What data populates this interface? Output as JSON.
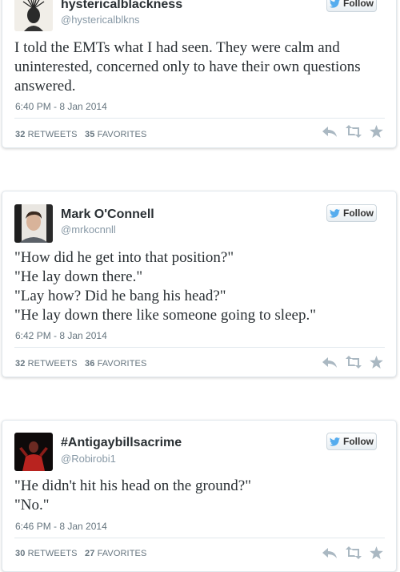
{
  "tweets": [
    {
      "name": "hystericalblackness",
      "handle": "@hystericalblkns",
      "follow_label": "Follow",
      "text_lines": [
        "I told the EMTs what I had seen. They were calm and",
        "uninterested, concerned only to have their own questions",
        "answered."
      ],
      "timestamp": "6:40 PM - 8 Jan 2014",
      "retweets": "32",
      "retweets_label": "RETWEETS",
      "favorites": "35",
      "favorites_label": "FAVORITES"
    },
    {
      "name": "Mark O'Connell",
      "handle": "@mrkocnnll",
      "follow_label": "Follow",
      "text_lines": [
        "\"How did he get into that position?\"",
        "\"He lay down there.\"",
        "\"Lay how? Did he bang his head?\"",
        "\"He lay down there like someone going to sleep.\""
      ],
      "timestamp": "6:42 PM - 8 Jan 2014",
      "retweets": "32",
      "retweets_label": "RETWEETS",
      "favorites": "36",
      "favorites_label": "FAVORITES"
    },
    {
      "name": "#Antigaybillsacrime",
      "handle": "@Robirobi1",
      "follow_label": "Follow",
      "text_lines": [
        "\"He didn't hit his head on the ground?\"",
        "\"No.\""
      ],
      "timestamp": "6:46 PM - 8 Jan 2014",
      "retweets": "30",
      "retweets_label": "RETWEETS",
      "favorites": "27",
      "favorites_label": "FAVORITES"
    }
  ],
  "colors": {
    "twitter_blue": "#55acee",
    "muted": "#8899a6",
    "icon_grey": "#aab8c2"
  },
  "icons": [
    "twitter-bird-icon",
    "reply-icon",
    "retweet-icon",
    "favorite-star-icon"
  ]
}
